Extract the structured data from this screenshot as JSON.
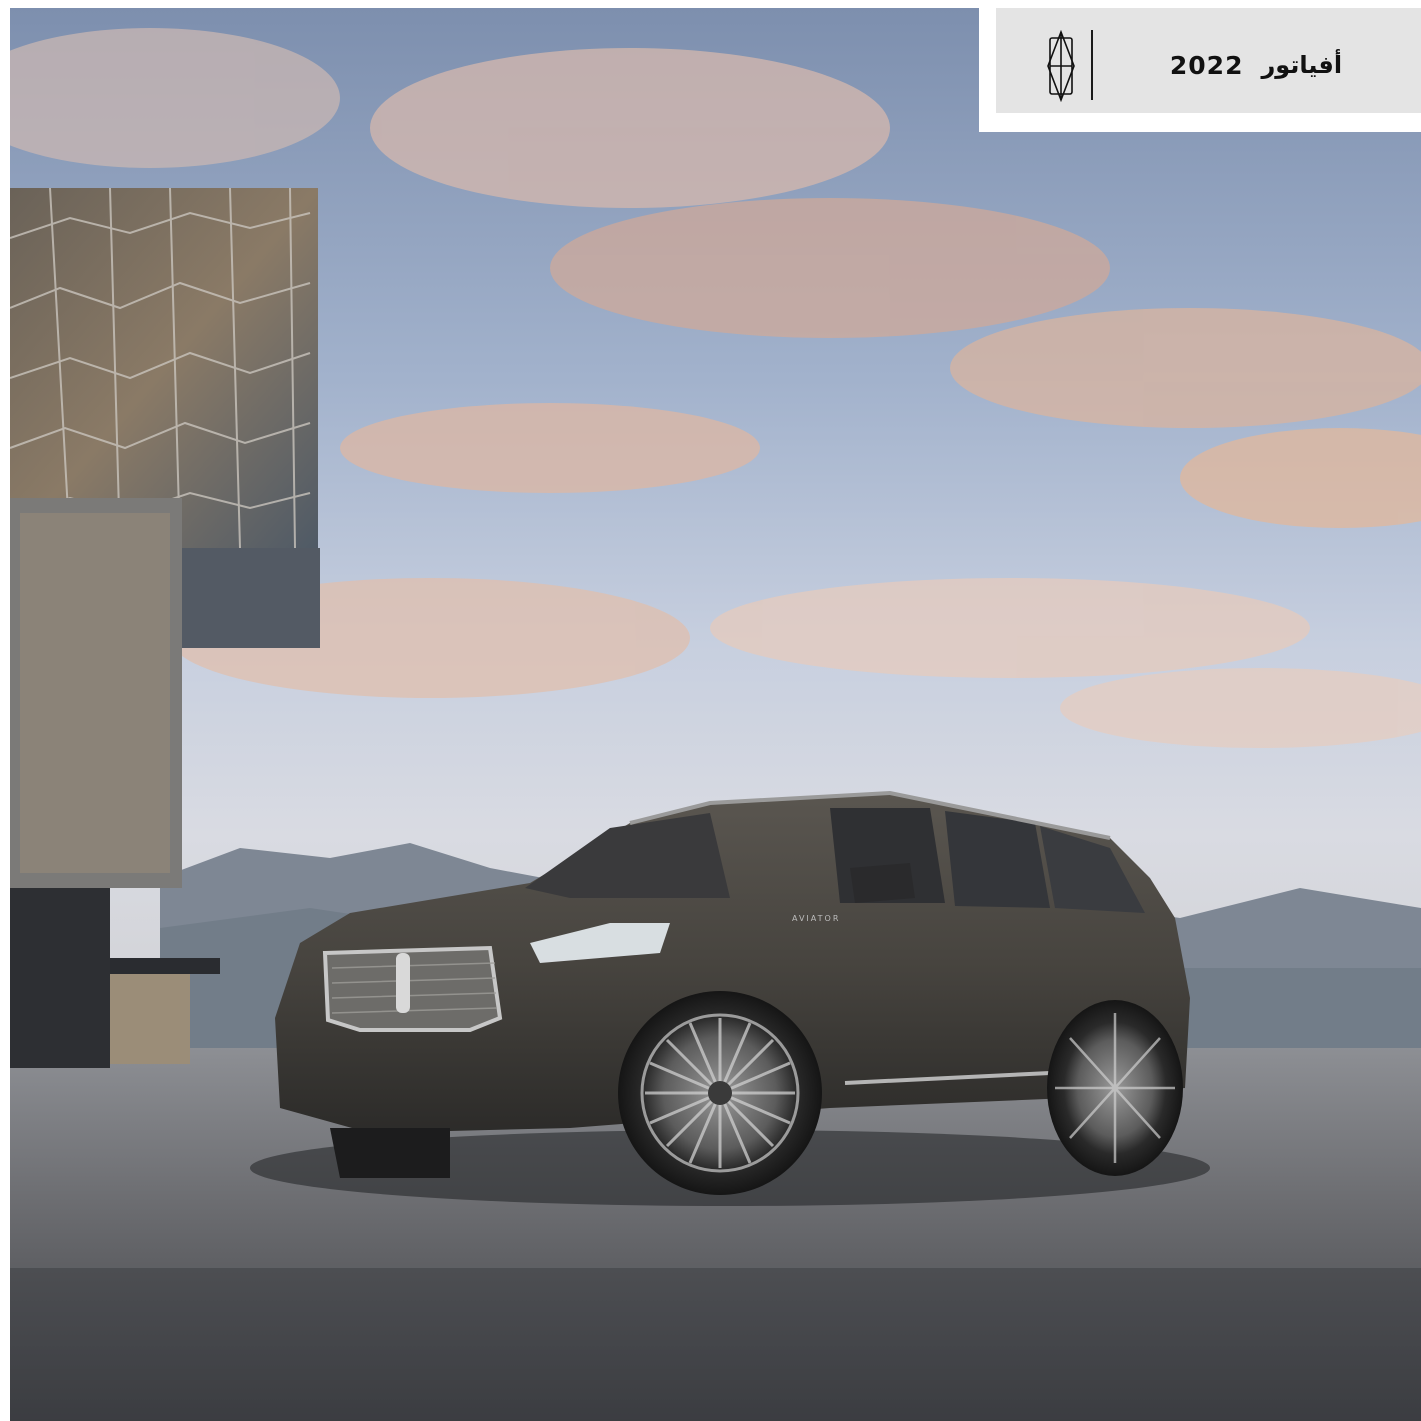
{
  "header": {
    "model_name": "أفياتور",
    "model_year": "2022",
    "brand_logo_icon": "lincoln-star-icon"
  },
  "photo": {
    "badge_text": "AVIATOR"
  },
  "colors": {
    "header_background": "#e4e4e4",
    "header_text": "#111111",
    "car_body": "#4a4640"
  }
}
